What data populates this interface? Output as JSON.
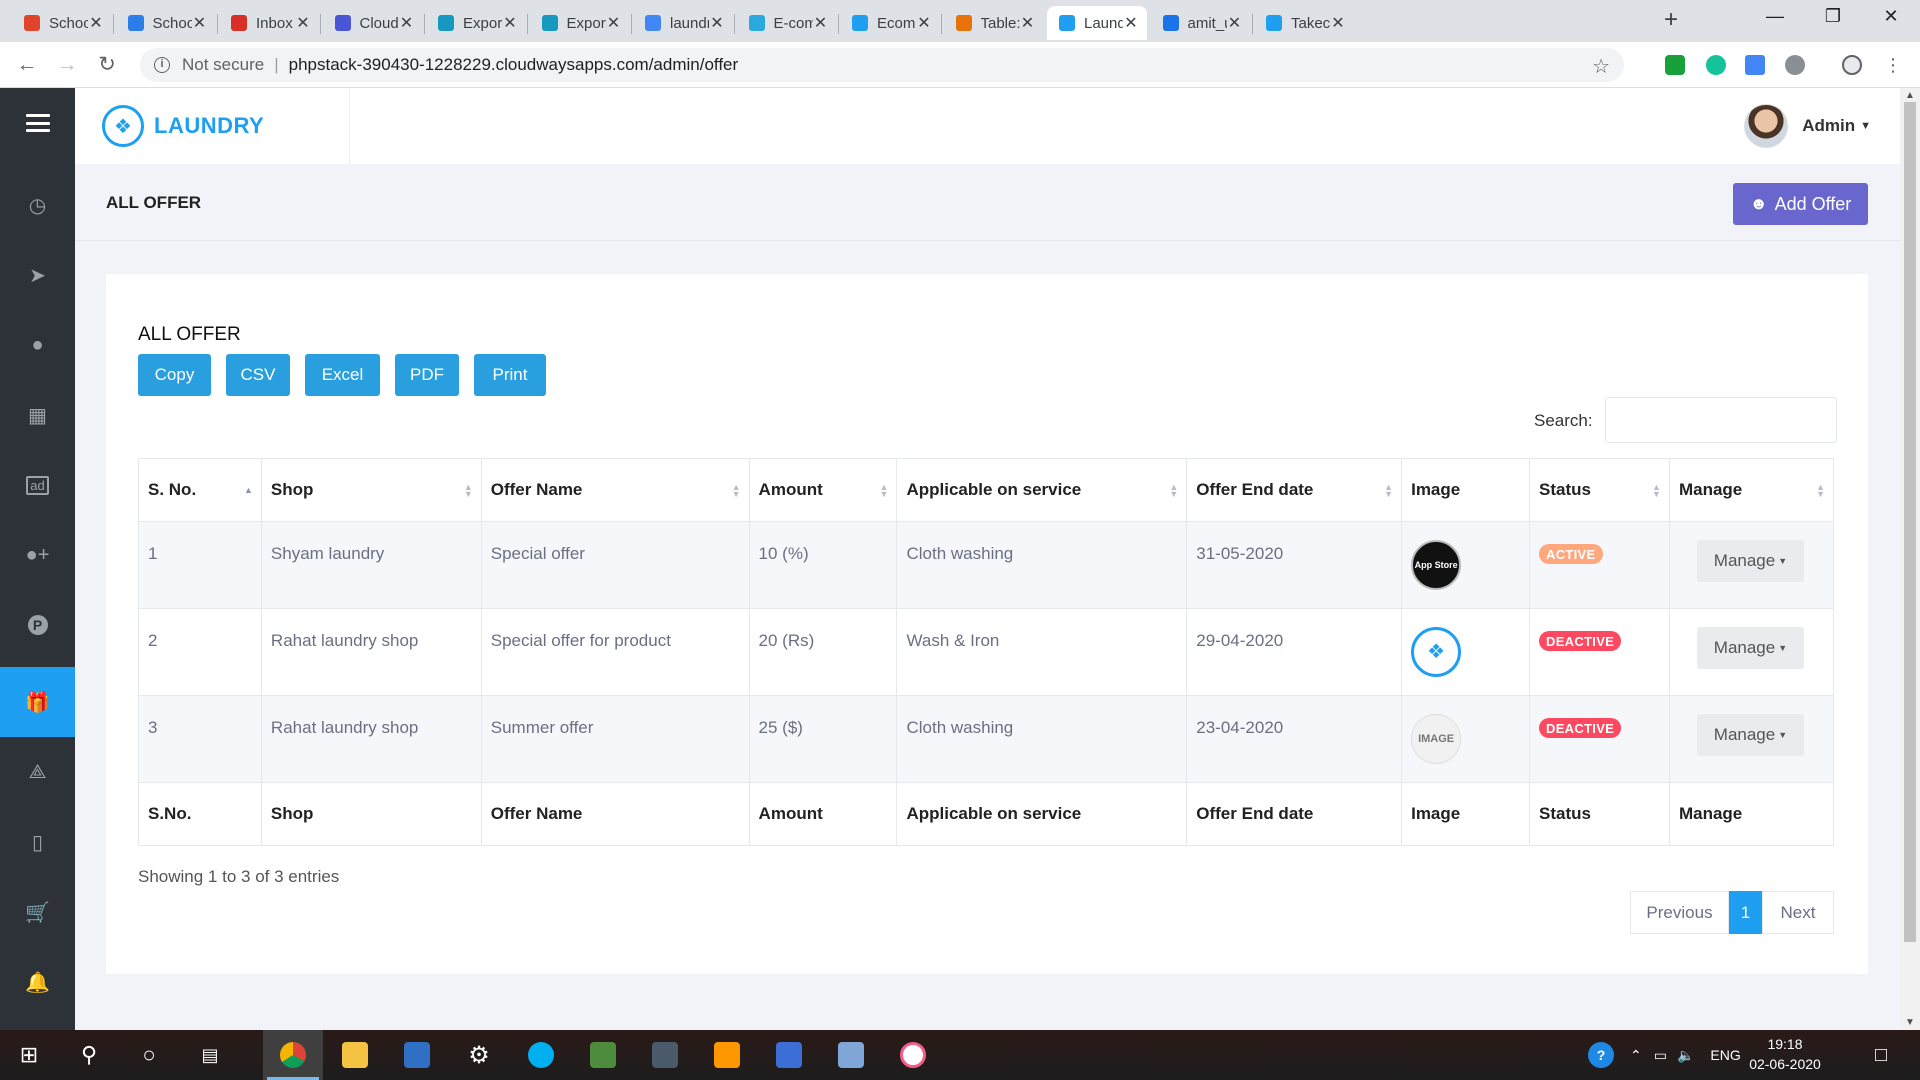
{
  "browser": {
    "tabs": [
      {
        "title": "School",
        "color": "#e0452c"
      },
      {
        "title": "School",
        "color": "#2b7de9"
      },
      {
        "title": "Inbox (",
        "color": "#d93025"
      },
      {
        "title": "Cloudv",
        "color": "#4a56d6"
      },
      {
        "title": "Export",
        "color": "#1798c1"
      },
      {
        "title": "Export",
        "color": "#1798c1"
      },
      {
        "title": "laundr",
        "color": "#4285f4"
      },
      {
        "title": "E-com",
        "color": "#2aa9e0"
      },
      {
        "title": "Ecomn",
        "color": "#1e9ff2"
      },
      {
        "title": "Table: ",
        "color": "#e8710a"
      },
      {
        "title": "Laundr",
        "color": "#1e9ff2"
      },
      {
        "title": "amit_u",
        "color": "#1a73e8"
      },
      {
        "title": "Takeca",
        "color": "#1e9ff2"
      }
    ],
    "active_tab_index": 10,
    "security_label": "Not secure",
    "url": "phpstack-390430-1228229.cloudwaysapps.com/admin/offer"
  },
  "app": {
    "brand": "LAUNDRY",
    "user": "Admin",
    "accent": "#1e9ff2"
  },
  "sidebar": {
    "items": [
      "menu-icon",
      "dashboard-icon",
      "send-icon",
      "user-icon",
      "table-icon",
      "ad-icon",
      "user-plus-icon",
      "parking-icon",
      "gift-icon",
      "tag-icon",
      "receipt-icon",
      "cart-icon",
      "bell-icon"
    ],
    "active": "gift-icon"
  },
  "page": {
    "title": "ALL OFFER",
    "add_button": "Add Offer"
  },
  "card": {
    "title": "ALL OFFER",
    "export_buttons": [
      "Copy",
      "CSV",
      "Excel",
      "PDF",
      "Print"
    ],
    "search_label": "Search:",
    "search_value": ""
  },
  "table": {
    "columns": [
      "S. No.",
      "Shop",
      "Offer Name",
      "Amount",
      "Applicable on service",
      "Offer End date",
      "Image",
      "Status",
      "Manage"
    ],
    "footer_columns": [
      "S.No.",
      "Shop",
      "Offer Name",
      "Amount",
      "Applicable on service",
      "Offer End date",
      "Image",
      "Status",
      "Manage"
    ],
    "rows": [
      {
        "sno": "1",
        "shop": "Shyam laundry",
        "offer": "Special offer",
        "amount": "10 (%)",
        "service": "Cloth washing",
        "end": "31-05-2020",
        "image": "App Store",
        "status": "ACTIVE",
        "manage": "Manage"
      },
      {
        "sno": "2",
        "shop": "Rahat laundry shop",
        "offer": "Special offer for product",
        "amount": "20 (Rs)",
        "service": "Wash & Iron",
        "end": "29-04-2020",
        "image": "tshirt-logo",
        "status": "DEACTIVE",
        "manage": "Manage"
      },
      {
        "sno": "3",
        "shop": "Rahat laundry shop",
        "offer": "Summer offer",
        "amount": "25 ($)",
        "service": "Cloth washing",
        "end": "23-04-2020",
        "image": "IMAGE",
        "status": "DEACTIVE",
        "manage": "Manage"
      }
    ]
  },
  "footer": {
    "info": "Showing 1 to 3 of 3 entries",
    "prev": "Previous",
    "current": "1",
    "next": "Next"
  },
  "taskbar": {
    "lang": "ENG",
    "time": "19:18",
    "date": "02-06-2020"
  }
}
